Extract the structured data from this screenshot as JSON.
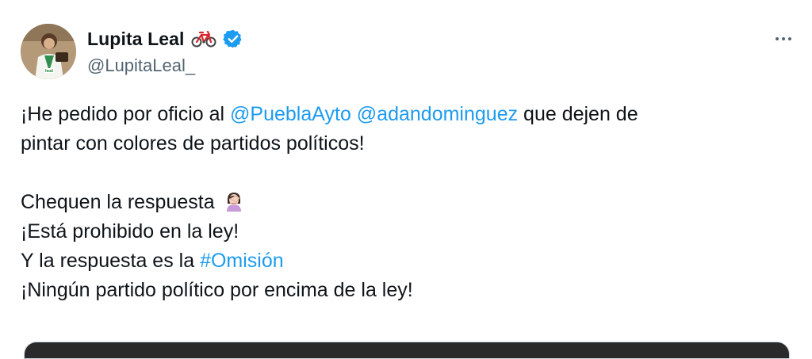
{
  "author": {
    "display_name": "Lupita Leal",
    "handle": "@LupitaLeal_",
    "verified": true,
    "name_emoji": "bicycle-icon",
    "avatar_caption": "leal"
  },
  "tweet": {
    "line1_pre": "¡He pedido por oficio al ",
    "mention1": "@PueblaAyto",
    "mention2": "@adandominguez",
    "line1_post": " que dejen de",
    "line2": "pintar con colores de partidos políticos!",
    "line3": "Chequen la respuesta",
    "line3_emoji": "woman-facepalming-icon",
    "line4": "¡Está prohibido en la ley!",
    "line5_pre": "Y la respuesta es la ",
    "hashtag": "#Omisión",
    "line6": "¡Ningún partido político por encima de la ley!"
  },
  "colors": {
    "text": "#0f1419",
    "secondary": "#536471",
    "link": "#1d9bf0",
    "verified": "#1d9bf0"
  }
}
